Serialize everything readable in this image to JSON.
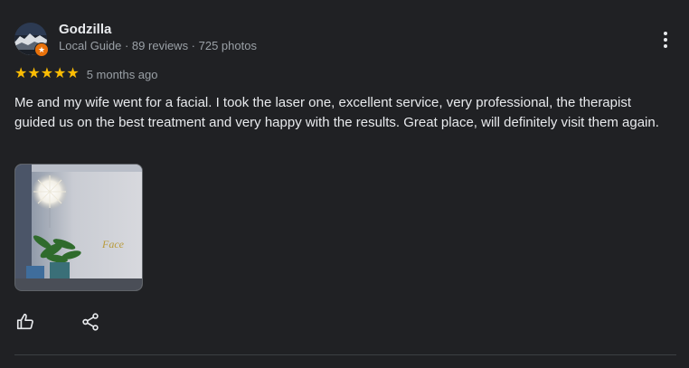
{
  "reviewer": {
    "name": "Godzilla",
    "meta": "Local Guide · 89 reviews · 725 photos",
    "avatar_icon": "landscape-avatar",
    "badge_icon": "local-guide-star-icon",
    "badge_color": "#e8710a"
  },
  "rating": {
    "stars": 5,
    "max_stars": 5,
    "stars_text": "★★★★★",
    "date": "5 months ago",
    "star_color": "#fbbc04"
  },
  "review": {
    "text": "Me and my wife went for a facial. I took the laser one, excellent service, very professional, the therapist guided us on the best treatment and very happy with the results. Great place, will definitely visit them again."
  },
  "photo": {
    "icon": "review-photo-thumbnail",
    "sign_text": "Face"
  },
  "actions": {
    "like_icon": "thumbs-up-icon",
    "share_icon": "share-icon",
    "more_icon": "more-vertical-icon"
  },
  "colors": {
    "background": "#202124",
    "primary_text": "#e8eaed",
    "secondary_text": "#9aa0a6"
  }
}
